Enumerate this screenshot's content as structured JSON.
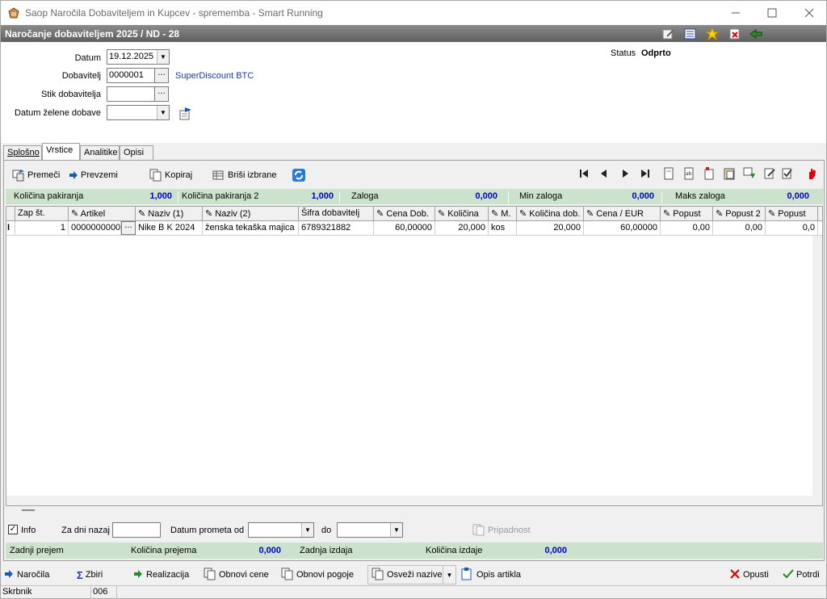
{
  "window": {
    "title": "Saop  Naročila Dobaviteljem in Kupcev - sprememba - Smart Running"
  },
  "header": {
    "title": "Naročanje dobaviteljem 2025 / ND - 28"
  },
  "form": {
    "datum_label": "Datum",
    "datum_value": "19.12.2025",
    "dobavitelj_label": "Dobavitelj",
    "dobavitelj_value": "0000001",
    "dobavitelj_name": "SuperDiscount BTC",
    "stik_label": "Stik dobavitelja",
    "stik_value": "",
    "zelena_label": "Datum želene dobave",
    "zelena_value": "",
    "status_label": "Status",
    "status_value": "Odprto"
  },
  "tabs": [
    "Splošno",
    "Vrstice",
    "Analitike",
    "Opisi"
  ],
  "toolbar": {
    "premeci": "Premeči",
    "prevzemi": "Prevzemi",
    "kopiraj": "Kopiraj",
    "brisi": "Briši izbrane"
  },
  "greenbar": {
    "kol_pak_label": "Količina pakiranja",
    "kol_pak_value": "1,000",
    "kol_pak2_label": "Količina pakiranja 2",
    "kol_pak2_value": "1,000",
    "zaloga_label": "Zaloga",
    "zaloga_value": "0,000",
    "min_label": "Min zaloga",
    "min_value": "0,000",
    "maks_label": "Maks zaloga",
    "maks_value": "0,000"
  },
  "grid": {
    "columns": [
      "Zap št.",
      "Artikel",
      "Naziv (1)",
      "Naziv (2)",
      "Šifra dobavitelj",
      "Cena Dob.",
      "Količina",
      "M.",
      "Količina dob.",
      "Cena / EUR",
      "Popust",
      "Popust 2",
      "Popust"
    ],
    "rows": [
      {
        "marker": "I",
        "zap": "1",
        "artikel": "000000000001",
        "naziv1": "Nike B K 2024",
        "naziv2": "ženska tekaška majica",
        "sifra": "6789321882",
        "cena_dob": "60,00000",
        "kolicina": "20,000",
        "m": "kos",
        "kol_dob": "20,000",
        "cena_eur": "60,00000",
        "popust": "0,00",
        "popust2": "0,00",
        "popust3": "0,0"
      }
    ]
  },
  "filters": {
    "info": "Info",
    "za_dni": "Za dni nazaj",
    "za_dni_value": "",
    "datum_od": "Datum prometa od",
    "do": "do",
    "pripadnost": "Pripadnost"
  },
  "greenbar2": {
    "zadnji_prejem": "Zadnji prejem",
    "kol_prejema": "Količina prejema",
    "kol_prejema_value": "0,000",
    "zadnja_izdaja": "Zadnja izdaja",
    "kol_izdaje": "Količina izdaje",
    "kol_izdaje_value": "0,000"
  },
  "footer": {
    "narocila": "Naročila",
    "zbiri": "Zbiri",
    "realizacija": "Realizacija",
    "obnovi_cene": "Obnovi cene",
    "obnovi_pogoje": "Obnovi pogoje",
    "osvezi": "Osveži nazive",
    "opis": "Opis artikla",
    "opusti": "Opusti",
    "potrdi": "Potrdi"
  },
  "status": {
    "user": "Skrbnik",
    "code": "006"
  }
}
